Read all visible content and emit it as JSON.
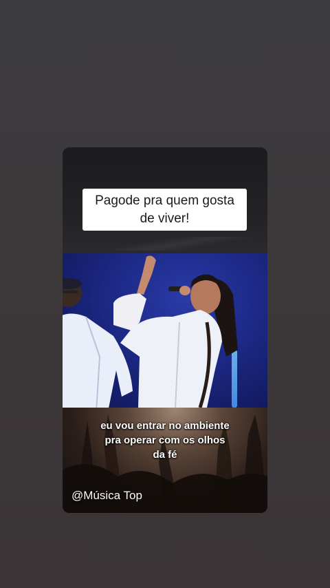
{
  "story": {
    "title": "Pagode pra quem gosta de viver!",
    "lyrics": [
      "eu vou entrar no ambiente",
      "pra operar com os olhos",
      "da fé"
    ],
    "handle": "@Música Top"
  },
  "colors": {
    "background": "#3c393b",
    "stage_blue": "#1d2a88",
    "title_box": "#ffffff"
  },
  "icons": []
}
